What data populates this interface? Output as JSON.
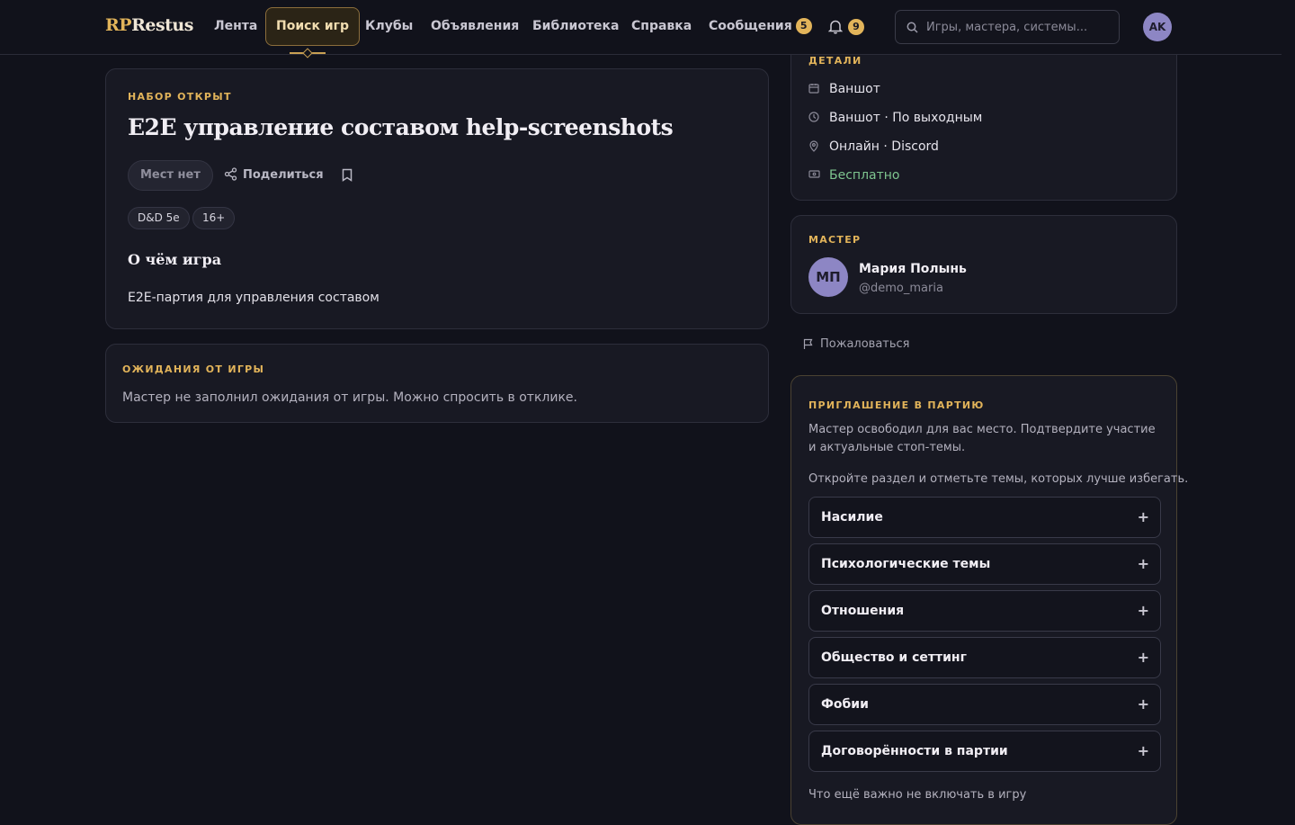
{
  "header": {
    "logo_rp": "RP",
    "logo_rest": "Restus",
    "nav": [
      {
        "label": "Лента"
      },
      {
        "label": "Поиск игр"
      },
      {
        "label": "Клубы"
      },
      {
        "label": "Объявления"
      },
      {
        "label": "Библиотека"
      },
      {
        "label": "Справка"
      },
      {
        "label": "Сообщения"
      }
    ],
    "messages_count": "5",
    "notifications_count": "9",
    "search_placeholder": "Игры, мастера, системы...",
    "user_initials": "AK"
  },
  "game": {
    "status": "НАБОР ОТКРЫТ",
    "title": "E2E управление составом help-screenshots",
    "seats_label": "Мест нет",
    "share_label": "Поделиться",
    "tags": [
      "D&D 5e",
      "16+"
    ],
    "about_heading": "О чём игра",
    "about_text": "E2E-партия для управления составом"
  },
  "expectations": {
    "heading": "ОЖИДАНИЯ ОТ ИГРЫ",
    "text": "Мастер не заполнил ожидания от игры. Можно спросить в отклике."
  },
  "details": {
    "heading": "ДЕТАЛИ",
    "format": "Ваншот",
    "schedule": "Ваншот · По выходным",
    "location": "Онлайн · Discord",
    "price": "Бесплатно"
  },
  "master": {
    "heading": "МАСТЕР",
    "initials": "МП",
    "name": "Мария Полынь",
    "handle": "@demo_maria"
  },
  "report_label": "Пожаловаться",
  "invite": {
    "heading": "ПРИГЛАШЕНИЕ В ПАРТИЮ",
    "text": "Мастер освободил для вас место. Подтвердите участие и актуальные стоп-темы.",
    "hint": "Откройте раздел и отметьте темы, которых лучше избегать.",
    "topics": [
      "Насилие",
      "Психологические темы",
      "Отношения",
      "Общество и сеттинг",
      "Фобии",
      "Договорённости в партии"
    ],
    "extra_label": "Что ещё важно не включать в игру"
  },
  "colors": {
    "accent": "#e2b45a",
    "background": "#11121b",
    "card": "#181923",
    "free": "#7ec58f",
    "avatar": "#8d86c4"
  }
}
